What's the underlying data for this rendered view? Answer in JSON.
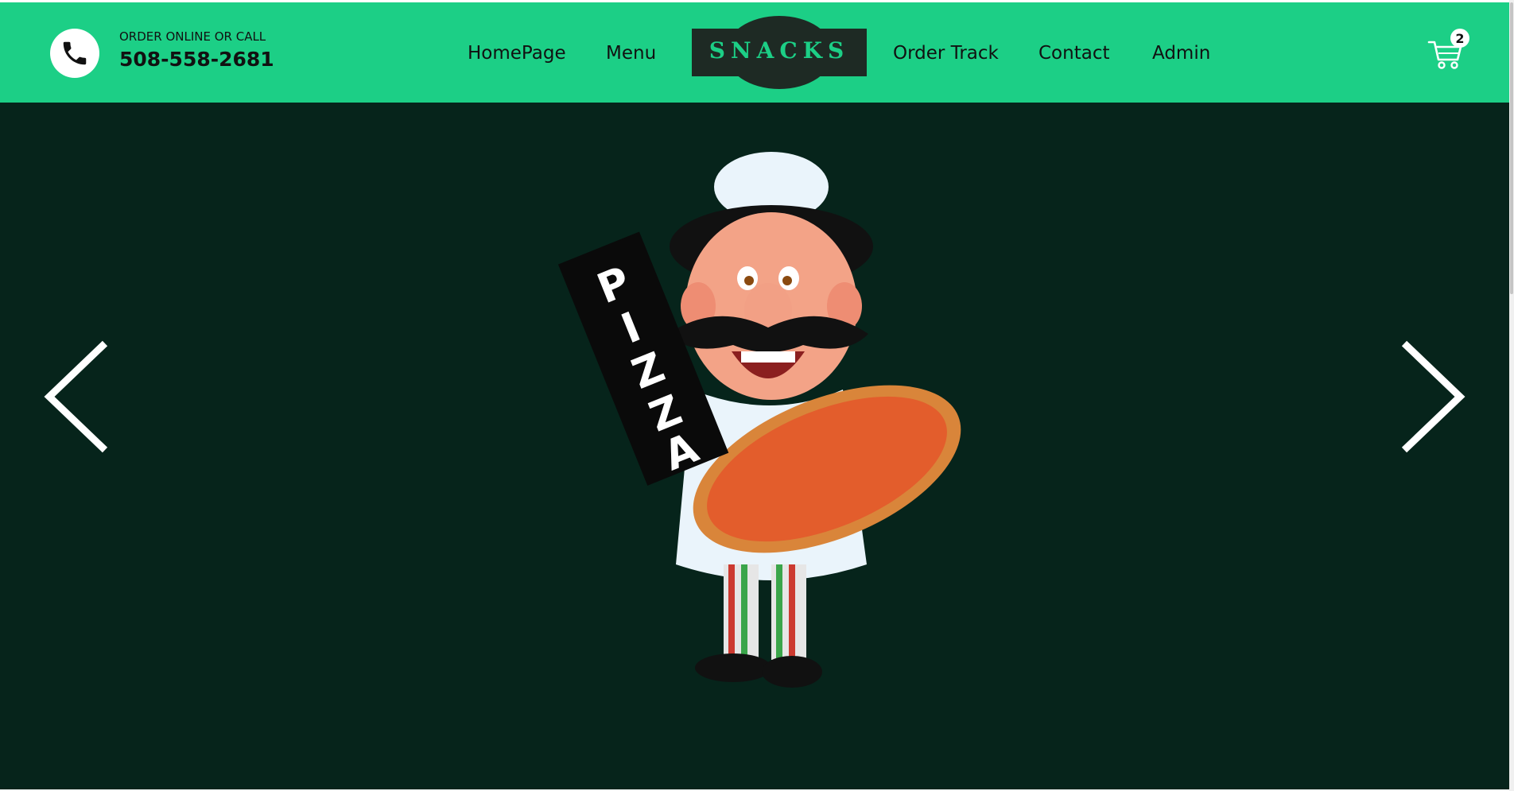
{
  "header": {
    "order_label": "ORDER ONLINE OR CALL",
    "phone_number": "508-558-2681",
    "logo_text": "SNACKS",
    "nav": {
      "homepage": "HomePage",
      "menu": "Menu",
      "order_track": "Order Track",
      "contact": "Contact",
      "admin": "Admin"
    },
    "cart_count": "2"
  },
  "hero": {
    "sign_text": "PIZZA",
    "prev_icon": "chevron-left-icon",
    "next_icon": "chevron-right-icon"
  },
  "colors": {
    "navbar": "#1ccf86",
    "hero_background": "#06241b",
    "logo_background": "#1e2a24"
  }
}
